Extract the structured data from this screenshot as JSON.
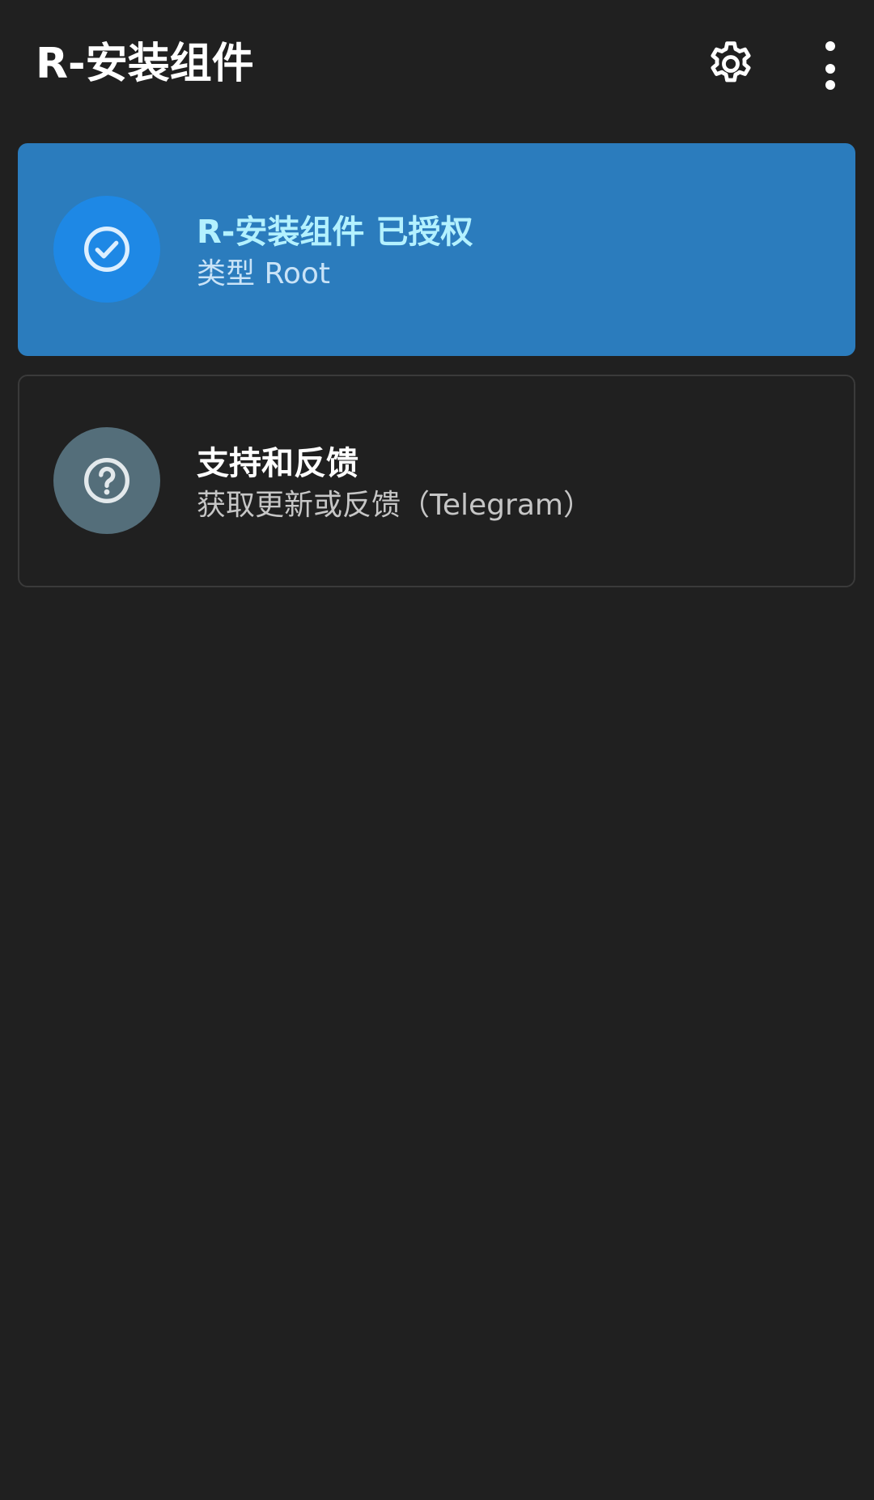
{
  "app_bar": {
    "title": "R-安装组件",
    "settings_icon": "gear-icon",
    "overflow_icon": "more-vert-icon"
  },
  "status_card": {
    "icon": "check-circle-icon",
    "title": "R-安装组件 已授权",
    "subtitle": "类型 Root",
    "colors": {
      "card_bg": "#2b7cbd",
      "icon_bg": "#1e88e5",
      "title": "#b3f1ff"
    }
  },
  "support_card": {
    "icon": "help-circle-icon",
    "title": "支持和反馈",
    "subtitle": "获取更新或反馈（Telegram）",
    "colors": {
      "icon_bg": "#546e7a",
      "border": "#3a3a3a"
    }
  },
  "theme": {
    "background": "#202020"
  }
}
